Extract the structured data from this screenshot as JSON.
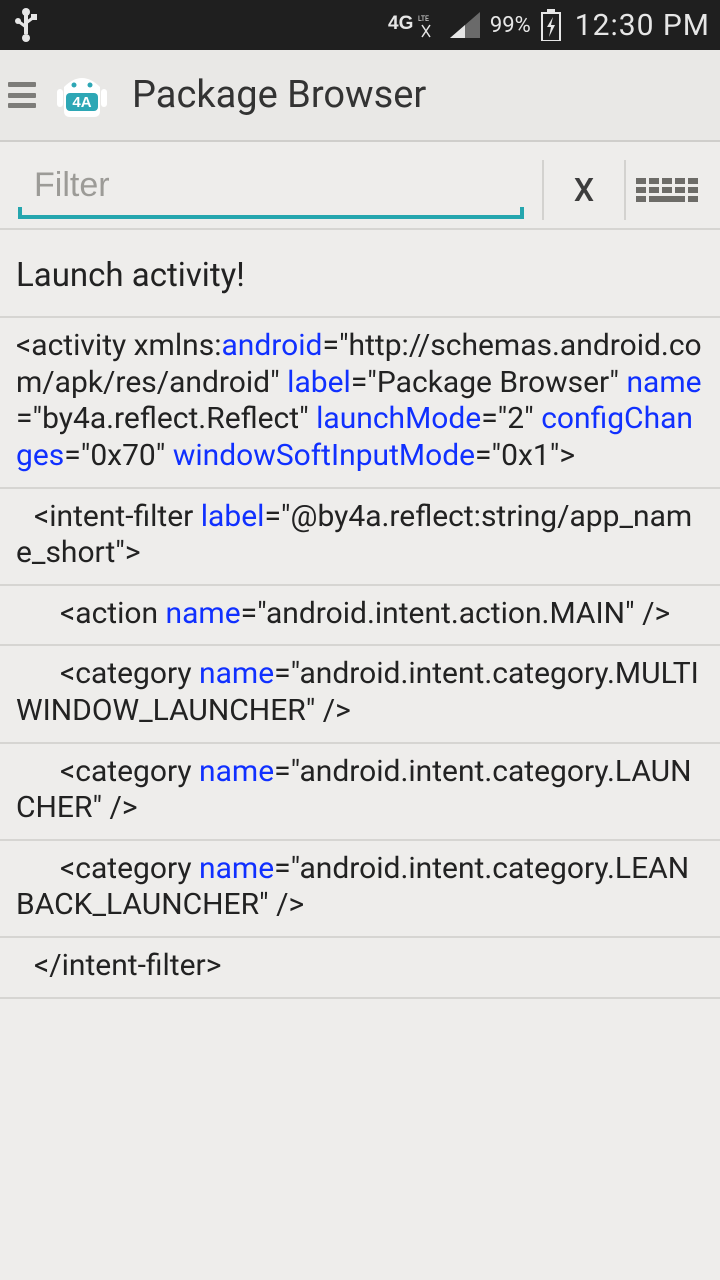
{
  "statusbar": {
    "network_label": "4G LTE",
    "battery_pct": "99%",
    "time": "12:30 PM"
  },
  "appbar": {
    "logo_text": "4A",
    "title": "Package Browser"
  },
  "filter": {
    "placeholder": "Filter",
    "clear_label": "X"
  },
  "rows": {
    "launch": "Launch activity!",
    "activity": {
      "pre1": "<activity xmlns:",
      "a1": "android",
      "post1": "=\"http://schemas.android.com/apk/res/android\" ",
      "a2": "label",
      "v2": "=\"Package Browser\" ",
      "a3": "name",
      "v3": "=\"by4a.reflect.Reflect\"  ",
      "a4": "launchMode",
      "v4": "=\"2\"  ",
      "a5": "configChanges",
      "v5": "=\"0x70\" ",
      "a6": "windowSoftInputMode",
      "v6": "=\"0x1\">"
    },
    "intentfilter": {
      "pre": "<intent-filter  ",
      "a": "label",
      "v": "=\"@by4a.reflect:string/app_name_short\">"
    },
    "action": {
      "pre": "<action  ",
      "a": "name",
      "v": "=\"android.intent.action.MAIN\" />"
    },
    "cat1": {
      "pre": "<category ",
      "a": "name",
      "v": "=\"android.intent.category.MULTIWINDOW_LAUNCHER\" />"
    },
    "cat2": {
      "pre": "<category ",
      "a": "name",
      "v": "=\"android.intent.category.LAUNCHER\" />"
    },
    "cat3": {
      "pre": "<category ",
      "a": "name",
      "v": "=\"android.intent.category.LEANBACK_LAUNCHER\" />"
    },
    "close": "</intent-filter>"
  }
}
